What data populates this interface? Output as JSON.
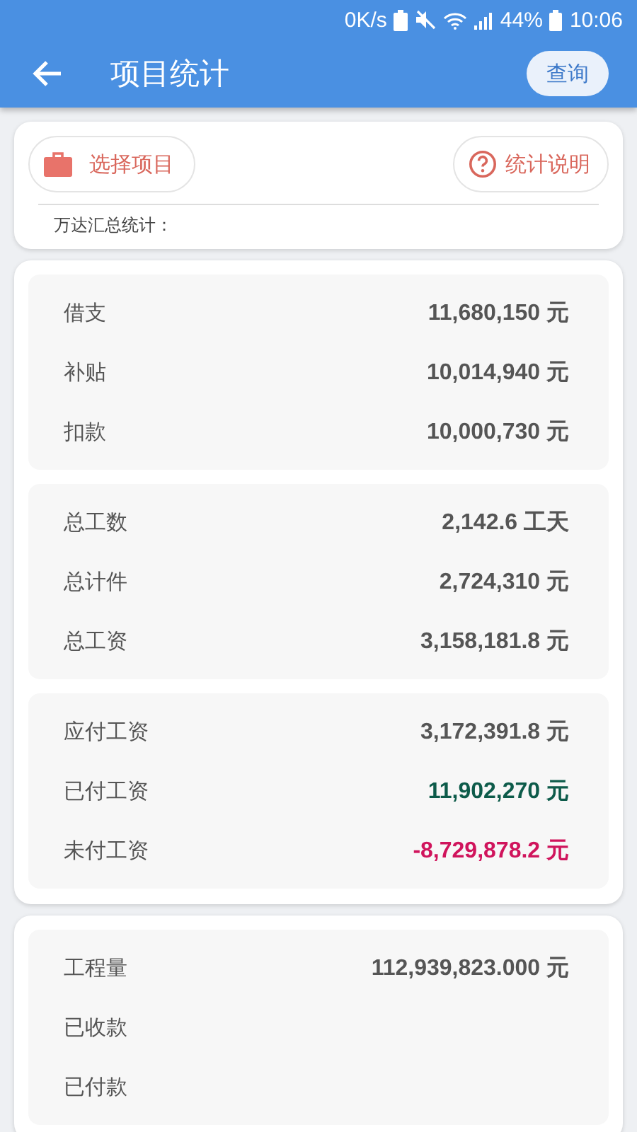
{
  "status_bar": {
    "speed": "0K/s",
    "battery": "44%",
    "time": "10:06"
  },
  "app_bar": {
    "title": "项目统计",
    "action": "查询"
  },
  "filter_card": {
    "select_button": "选择项目",
    "help_button": "统计说明",
    "summary_label": "万达汇总统计："
  },
  "stat_cards": [
    {
      "groups": [
        {
          "rows": [
            {
              "label": "借支",
              "value": "11,680,150 元",
              "kind": "plain"
            },
            {
              "label": "补贴",
              "value": "10,014,940 元",
              "kind": "plain"
            },
            {
              "label": "扣款",
              "value": "10,000,730 元",
              "kind": "plain"
            }
          ]
        },
        {
          "rows": [
            {
              "label": "总工数",
              "value": "2,142.6 工天",
              "kind": "plain"
            },
            {
              "label": "总计件",
              "value": "2,724,310 元",
              "kind": "plain"
            },
            {
              "label": "总工资",
              "value": "3,158,181.8 元",
              "kind": "plain"
            }
          ]
        },
        {
          "rows": [
            {
              "label": "应付工资",
              "value": "3,172,391.8 元",
              "kind": "plain"
            },
            {
              "label": "已付工资",
              "value": "11,902,270 元",
              "kind": "positive"
            },
            {
              "label": "未付工资",
              "value": "-8,729,878.2 元",
              "kind": "negative"
            }
          ]
        }
      ]
    },
    {
      "groups": [
        {
          "rows": [
            {
              "label": "工程量",
              "value": "112,939,823.000 元",
              "kind": "plain"
            },
            {
              "label": "已收款"
            },
            {
              "label": "已付款"
            }
          ]
        }
      ]
    }
  ]
}
